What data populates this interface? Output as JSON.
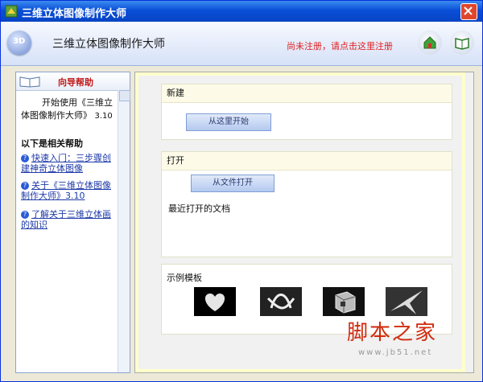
{
  "window": {
    "title": "三维立体图像制作大师",
    "close_symbol": "✕"
  },
  "header": {
    "title": "三维立体图像制作大师",
    "logo_text": "3D",
    "register_link": "尚未注册，请点击这里注册"
  },
  "sidebar": {
    "heading": "向导帮助",
    "intro": "开始使用《三维立体图像制作大师》",
    "intro_version": "3.10",
    "related_heading": "以下是相关帮助",
    "help_links": [
      "快速入门：三步骤创建神奇立体图像",
      "关于《三维立体图像制作大师》3.10",
      "了解关于三维立体画的知识"
    ]
  },
  "main": {
    "new_section": {
      "heading": "新建",
      "start_button": "从这里开始"
    },
    "open_section": {
      "heading": "打开",
      "open_button": "从文件打开",
      "recent_label": "最近打开的文档"
    },
    "samples_section": {
      "heading": "示例模板",
      "thumbnails": [
        "heart",
        "knot",
        "cube",
        "bird"
      ]
    }
  },
  "watermark": {
    "text": "脚本之家",
    "url": "www.jb51.net"
  },
  "colors": {
    "titlebar": "#0a4fd8",
    "accent_red": "#e02020",
    "link_blue": "#1e3aa8"
  }
}
